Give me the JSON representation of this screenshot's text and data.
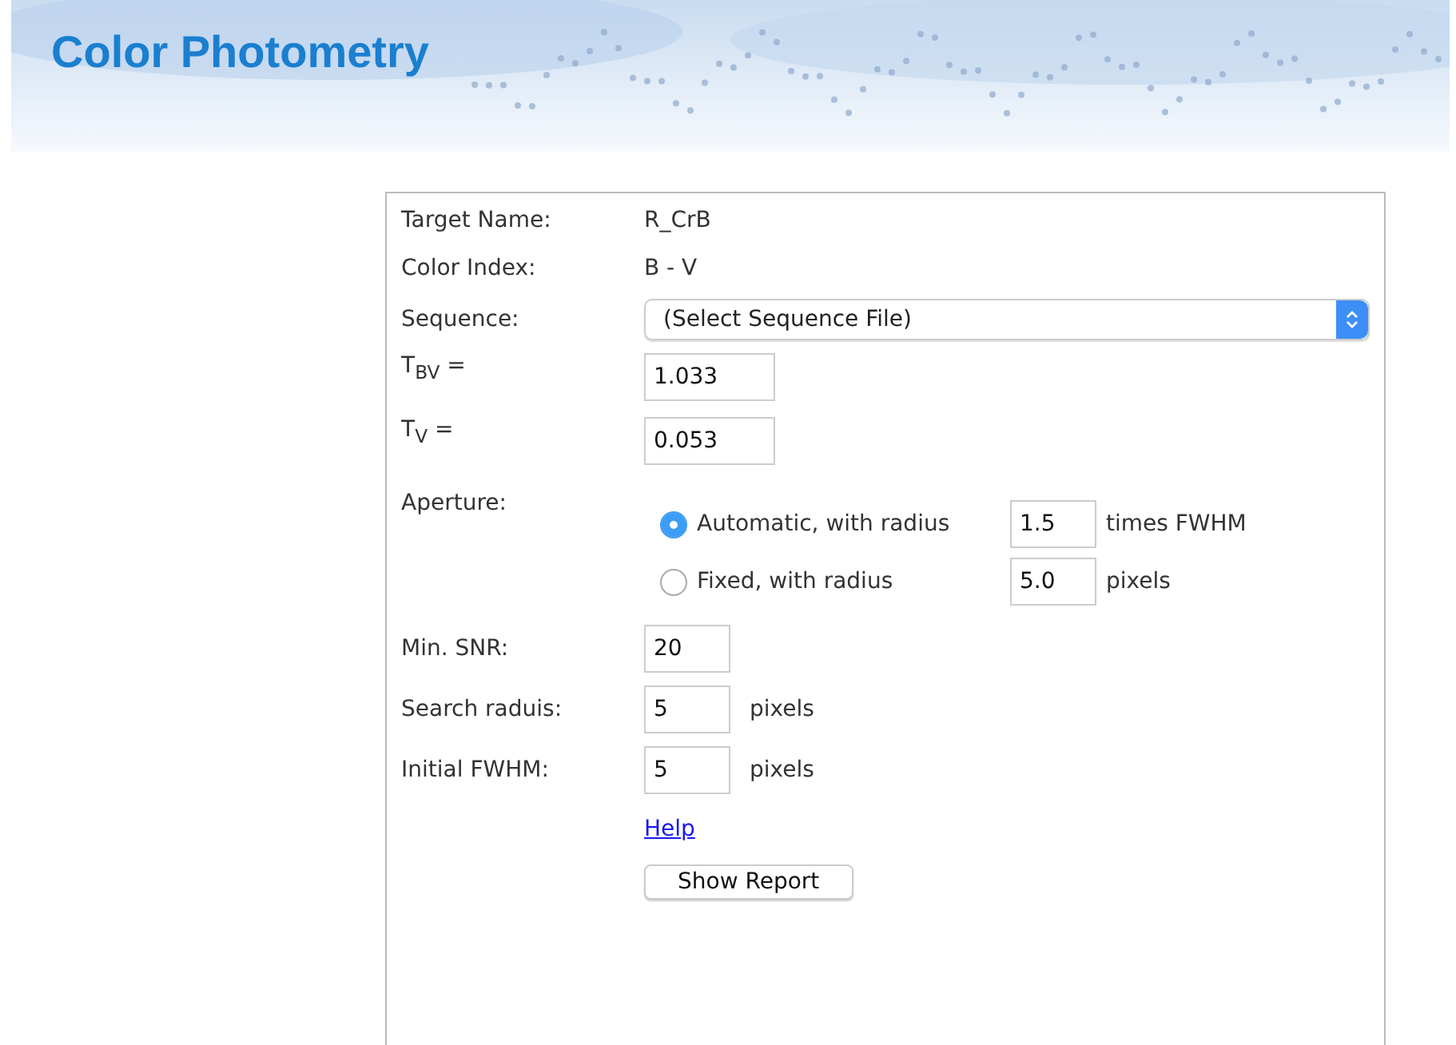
{
  "header": {
    "title": "Color Photometry"
  },
  "info": [
    {
      "label": "Target Name:",
      "value": "R_CrB"
    },
    {
      "label": "Color Index:",
      "value": "B - V"
    }
  ],
  "sequence": {
    "label": "Sequence:",
    "value": "(Select Sequence File)"
  },
  "coefficients": [
    {
      "label": "T$_{BV}$ =",
      "value": "1.033"
    },
    {
      "label": "T$_{V}$ =",
      "value": "0.053"
    }
  ],
  "aperture": {
    "label": "Aperture:",
    "options": [
      {
        "label": "Automatic, with radius",
        "selected": true,
        "value": "1.5",
        "unit": "times FWHM"
      },
      {
        "label": "Fixed, with radius",
        "selected": false,
        "value": "5.0",
        "unit": "pixels"
      }
    ]
  },
  "params": [
    {
      "label": "Min. SNR:",
      "value": "20"
    },
    {
      "label": "Search raduis:",
      "value": "5",
      "unit": "pixels"
    },
    {
      "label": "Initial FWHM:",
      "value": "5",
      "unit": "pixels"
    }
  ],
  "help_link": "Help",
  "button": "Show Report"
}
